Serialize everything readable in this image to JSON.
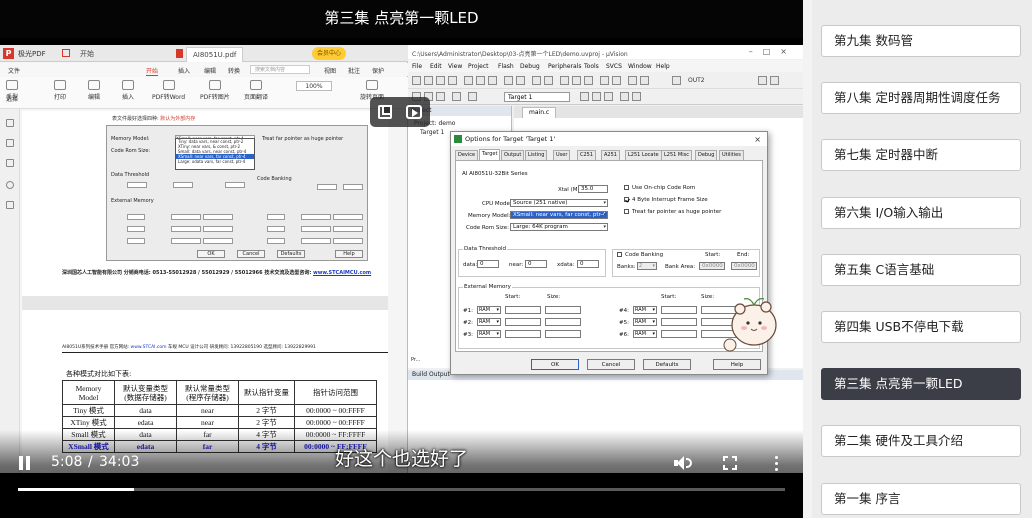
{
  "player": {
    "title": "第三集 点亮第一颗LED",
    "subtitle": "好这个也选好了",
    "time_current": "5:08",
    "time_separator": "/",
    "time_total": "34:03",
    "progress": 0.151
  },
  "pdf_app": {
    "app_name": "极光PDF",
    "tabs": [
      "开始",
      "AI8051U.pdf"
    ],
    "member_badge": "会员中心",
    "menus": [
      "文件",
      "开始",
      "插入",
      "编辑",
      "转换",
      "视图",
      "批注",
      "保护",
      "帮助"
    ],
    "search_placeholder": "搜索文档内容",
    "toolbar": [
      {
        "name": "hand",
        "label": "手型"
      },
      {
        "name": "select",
        "label": "选择"
      },
      {
        "name": "print",
        "label": "打印"
      },
      {
        "name": "edit",
        "label": "编辑"
      },
      {
        "name": "insert",
        "label": "插入"
      },
      {
        "name": "pdf-to-word",
        "label": "PDF转Word"
      },
      {
        "name": "pdf-to-image",
        "label": "PDF转图片"
      },
      {
        "name": "translate",
        "label": "页面翻译"
      },
      {
        "name": "rotate",
        "label": "旋转页面"
      }
    ],
    "zoom": "100%",
    "doc": {
      "dialog_strip": "表文件最好选择四种:",
      "dialog_strip_red": "默认为外部内存",
      "dialog": {
        "memory_model_label": "Memory Model:",
        "memory_model_value": "XSmall: near vars, far const, ptr-4",
        "code_rom_label": "Code Rom Size:",
        "data_threshold": "Data Threshold",
        "external_memory": "External Memory",
        "dropdown_options": [
          "Tiny: data vars, near const, ptr-2",
          "XTiny: near vars, & const, ptr-2",
          "Small: data vars, near const, ptr-4",
          "XSmall: near vars, far const, ptr-4",
          "Large: xdata vars, far const, ptr-4"
        ],
        "huge_pointer": "Treat far pointer as huge pointer",
        "code_banking": "Code Banking",
        "ok": "OK",
        "cancel": "Cancel",
        "defaults": "Defaults",
        "help": "Help"
      },
      "company_line": "深圳国芯人工智能有限公司  分销商电话: 0513-55012928 / 55012929 / 55012966  技术交流及选型咨询:",
      "company_url": "www.STCAIMCU.com",
      "header_line": "AI8051U系列技术手册   官方网站:",
      "header_url": "www.STCAI.com",
      "header_rest": "  车规 MCU 设计公司   研发顾问: 13922805190  选型顾问: 13922829991",
      "caption": "各种模式对比如下表:",
      "table_headers": [
        "Memory Model",
        "默认变量类型\n(数据存储器)",
        "默认常量类型\n(程序存储器)",
        "默认指针变量",
        "指针访问范围"
      ],
      "table_rows": [
        [
          "Tiny 模式",
          "data",
          "near",
          "2 字节",
          "00:0000 ~ 00:FFFF"
        ],
        [
          "XTiny 模式",
          "edata",
          "near",
          "2 字节",
          "00:0000 ~ 00:FFFF"
        ],
        [
          "Small 模式",
          "data",
          "far",
          "4 字节",
          "00:0000 ~ FF:FFFF"
        ],
        [
          "XSmall 模式",
          "edata",
          "far",
          "4 字节",
          "00:0000 ~ FF:FFFF"
        ]
      ]
    }
  },
  "uvision": {
    "path": "C:\\Users\\Administrator\\Desktop\\03-点亮第一个LED\\demo.uvproj - µVision",
    "menus": [
      "File",
      "Edit",
      "View",
      "Project",
      "Flash",
      "Debug",
      "Peripherals",
      "Tools",
      "SVCS",
      "Window",
      "Help"
    ],
    "out_label": "OUT2",
    "target_combo": "Target 1",
    "project_header": "Project",
    "project_tree": [
      "Project: demo",
      "Target 1"
    ],
    "editor_tab": "main.c",
    "build_output": "Build Output",
    "pr_tab": "Pr...",
    "dialog": {
      "title": "Options for Target 'Target 1'",
      "tabs": [
        "Device",
        "Target",
        "Output",
        "Listing",
        "User",
        "C251",
        "A251",
        "L251 Locate",
        "L251 Misc",
        "Debug",
        "Utilities"
      ],
      "series": "AI AI8051U-32Bit Series",
      "xtal_label": "Xtal (MHz):",
      "xtal_value": "35.0",
      "cpu_mode_label": "CPU Mode:",
      "cpu_mode_value": "Source (251 native)",
      "memory_model_label": "Memory Model:",
      "memory_model_value": "XSmall: near vars, far const, ptr-4",
      "code_rom_label": "Code Rom Size:",
      "code_rom_value": "Large: 64K program",
      "use_onchip": "Use On-chip Code Rom",
      "byte_frame": "4 Byte Interrupt Frame Size",
      "huge_pointer": "Treat far pointer as huge pointer",
      "data_threshold": "Data Threshold",
      "data_label": "data:",
      "data_value": "0",
      "near_label": "near:",
      "near_value": "0",
      "xdata_label": "xdata:",
      "xdata_value": "0",
      "code_banking": "Code Banking",
      "start_label": "Start:",
      "end_label": "End:",
      "banks_label": "Banks:",
      "banks_value": "2",
      "bank_area_label": "Bank Area:",
      "bank_start": "0x0000",
      "bank_end": "0x0000",
      "external_memory": "External Memory",
      "size_label": "Size:",
      "ram_label": "RAM",
      "mem_rows_left": [
        "#1:",
        "#2:",
        "#3:"
      ],
      "mem_rows_right": [
        "#4:",
        "#5:",
        "#6:"
      ],
      "ok": "OK",
      "cancel": "Cancel",
      "defaults": "Defaults",
      "help": "Help"
    }
  },
  "playlist": [
    {
      "label": "第九集 数码管",
      "active": false
    },
    {
      "label": "第八集 定时器周期性调度任务",
      "active": false
    },
    {
      "label": "第七集 定时器中断",
      "active": false
    },
    {
      "label": "第六集 I/O输入输出",
      "active": false
    },
    {
      "label": "第五集 C语言基础",
      "active": false
    },
    {
      "label": "第四集 USB不停电下载",
      "active": false
    },
    {
      "label": "第三集 点亮第一颗LED",
      "active": true
    },
    {
      "label": "第二集 硬件及工具介绍",
      "active": false
    },
    {
      "label": "第一集 序言",
      "active": false
    }
  ]
}
